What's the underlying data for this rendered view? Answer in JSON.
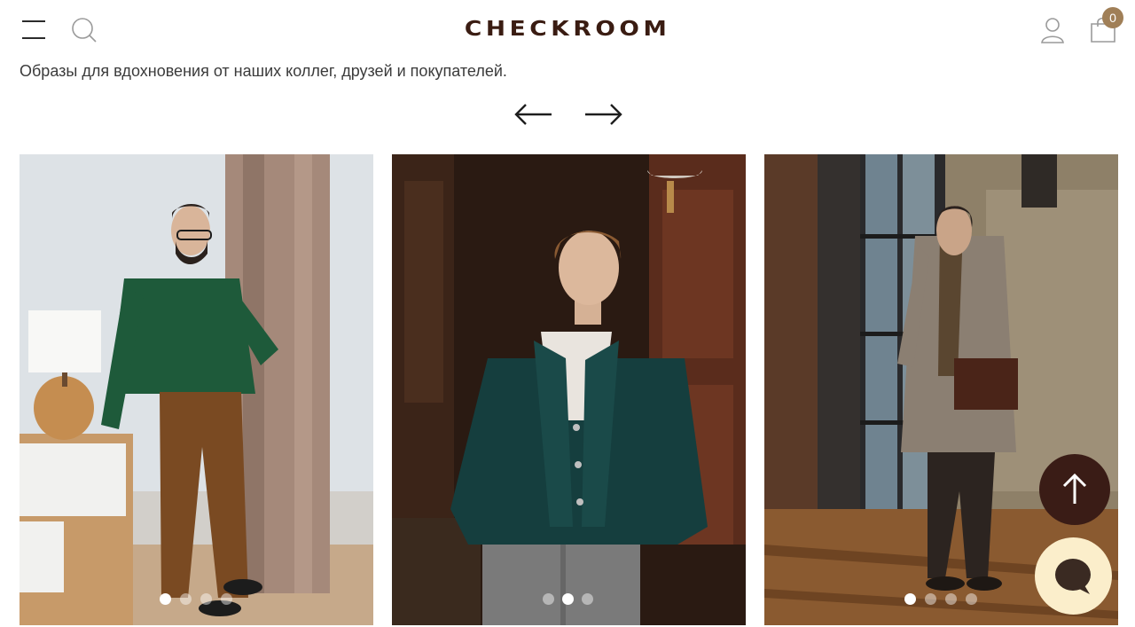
{
  "header": {
    "logo": "CHECKROOM",
    "cart_count": "0",
    "icons": {
      "menu": "menu-icon",
      "search": "search-icon",
      "account": "user-icon",
      "cart": "shopping-bag-icon"
    }
  },
  "intro_text": "Образы для вдохновения от наших коллег, друзей и покупателей.",
  "carousel": {
    "prev_icon": "arrow-left-icon",
    "next_icon": "arrow-right-icon",
    "cards": [
      {
        "subject": "man in green cable-knit sweater and brown corduroy trousers",
        "dots": 4,
        "active_dot": 1
      },
      {
        "subject": "man in dark green shawl-collar cardigan",
        "dots": 3,
        "active_dot": 2
      },
      {
        "subject": "man in grey overcoat with paisley scarf",
        "dots": 4,
        "active_dot": 1
      }
    ]
  },
  "floating": {
    "scroll_top_icon": "arrow-up-icon",
    "chat_icon": "chat-bubble-icon"
  },
  "colors": {
    "logo": "#3a1c12",
    "badge": "#a07f57",
    "scroll_top_bg": "#3a1c16",
    "chat_bg": "#fbeecb",
    "chat_icon": "#3a2a22"
  }
}
